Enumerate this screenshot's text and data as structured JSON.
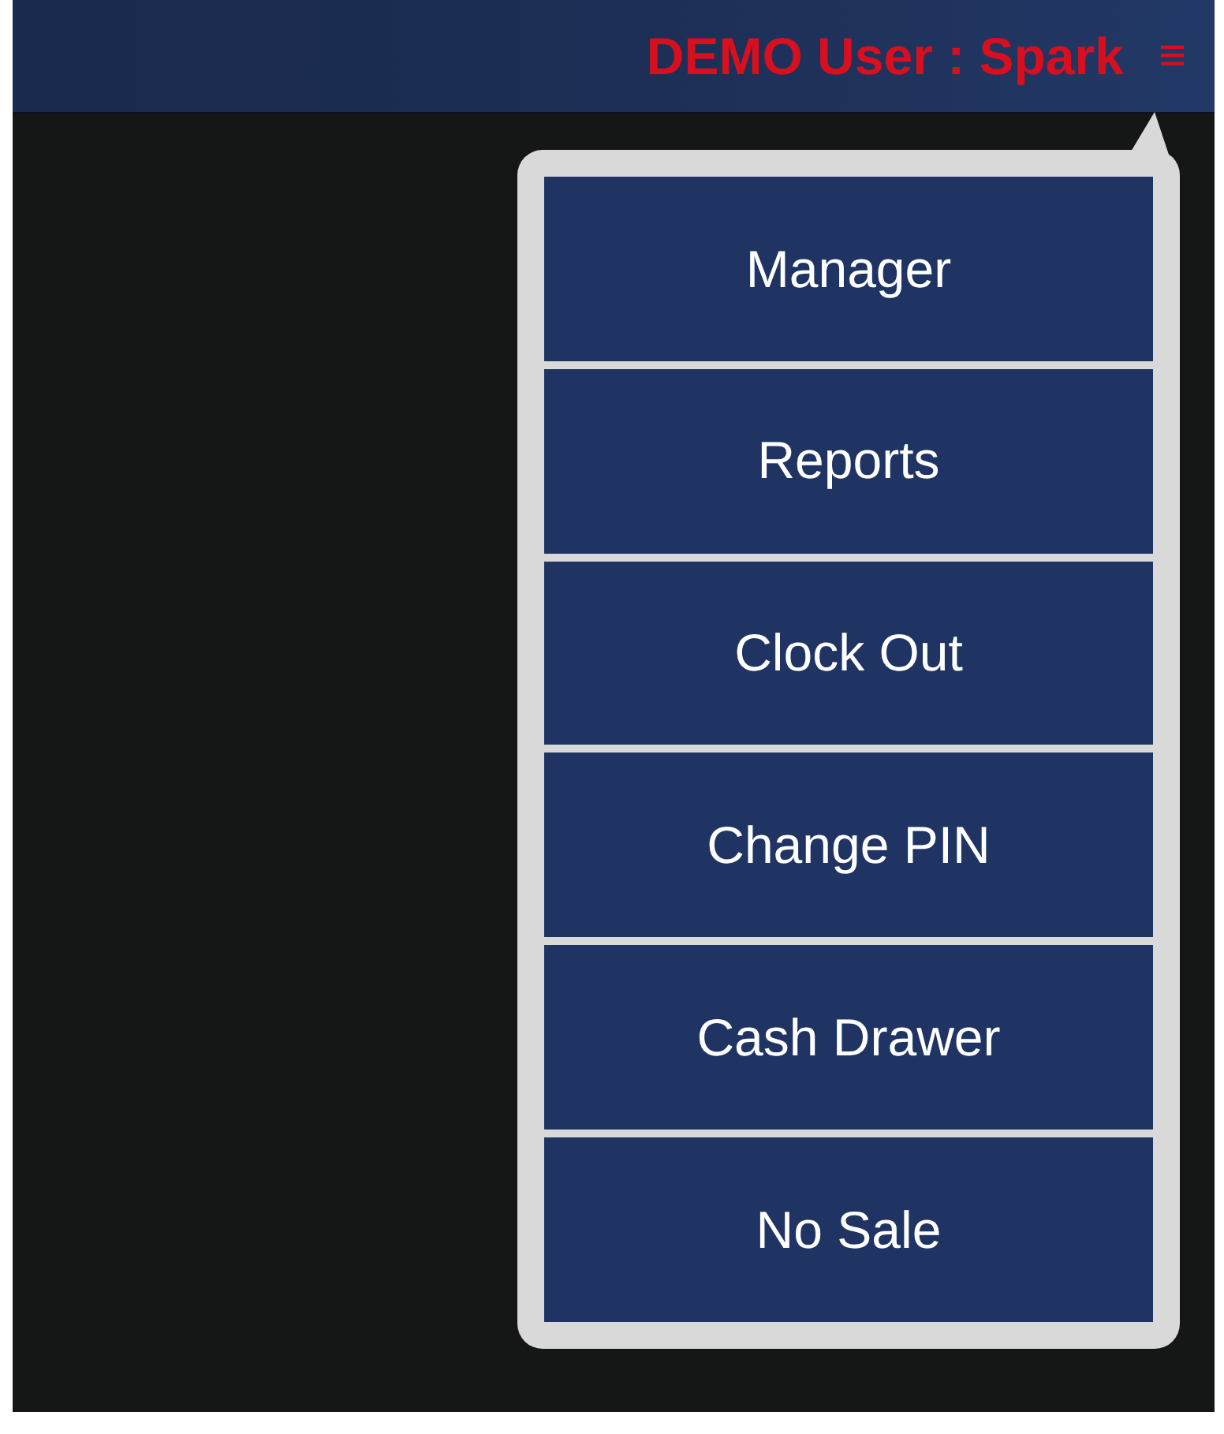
{
  "header": {
    "title": "DEMO User : Spark",
    "menu_glyph": "≡"
  },
  "menu": {
    "items": [
      {
        "label": "Manager"
      },
      {
        "label": "Reports"
      },
      {
        "label": "Clock Out"
      },
      {
        "label": "Change PIN"
      },
      {
        "label": "Cash Drawer"
      },
      {
        "label": "No Sale"
      }
    ]
  }
}
